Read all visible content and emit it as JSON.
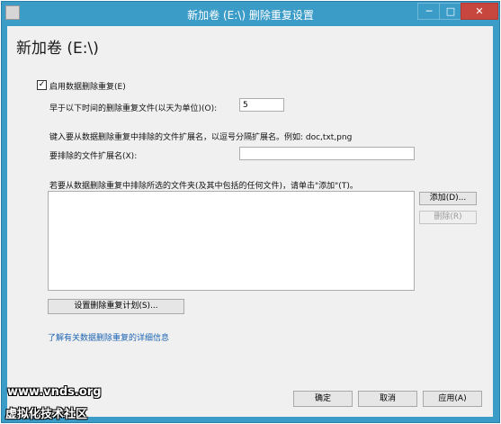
{
  "window": {
    "title": "新加卷 (E:\\) 删除重复设置",
    "controls": {
      "minimize": "─",
      "maximize": "□",
      "close": "✕"
    }
  },
  "page": {
    "heading": "新加卷 (E:\\)"
  },
  "dedup": {
    "enable_label": "启用数据删除重复(E)",
    "enabled": true,
    "age_label": "早于以下时间的删除重复文件(以天为单位)(O):",
    "age_value": "5"
  },
  "exclude_ext": {
    "instruction": "键入要从数据删除重复中排除的文件扩展名，以逗号分隔扩展名。例如: doc,txt,png",
    "label": "要排除的文件扩展名(X):",
    "value": ""
  },
  "exclude_folders": {
    "instruction": "若要从数据删除重复中排除所选的文件夹(及其中包括的任何文件)，请单击\"添加\"(T)。",
    "add_label": "添加(D)...",
    "remove_label": "删除(R)"
  },
  "schedule_button": "设置删除重复计划(S)...",
  "learn_more_link": "了解有关数据删除重复的详细信息",
  "footer": {
    "ok": "确定",
    "cancel": "取消",
    "apply": "应用(A)"
  },
  "watermark": {
    "line1": "www.vnds.org",
    "line2": "虚拟化技术社区"
  }
}
